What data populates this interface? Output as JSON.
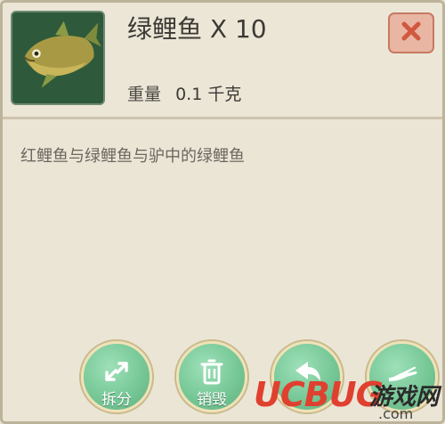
{
  "item": {
    "name": "绿鲤鱼 X 10",
    "weight_label": "重量",
    "weight_value": "0.1 千克",
    "description": "红鲤鱼与绿鲤鱼与驴中的绿鲤鱼",
    "icon": "fish-icon"
  },
  "close": {
    "icon": "close-icon"
  },
  "actions": [
    {
      "label": "拆分",
      "icon": "split-arrows-icon"
    },
    {
      "label": "销毁",
      "icon": "trash-icon"
    },
    {
      "label": "",
      "icon": "back-arrow-icon"
    },
    {
      "label": "",
      "icon": "hand-icon"
    }
  ],
  "watermark": {
    "brand": "UCBUG",
    "cn": "游戏网",
    "domain": ".com"
  },
  "colors": {
    "panel": "#ebe5d6",
    "close_bg": "#e8b6a3",
    "close_x": "#d1583f",
    "action_green": "#77c897",
    "watermark_red": "#e0402f"
  }
}
